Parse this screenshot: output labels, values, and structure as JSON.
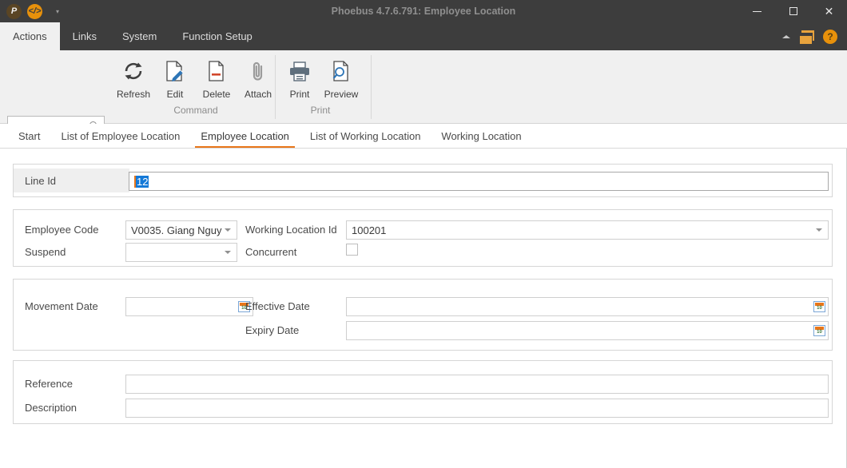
{
  "window": {
    "title": "Phoebus 4.7.6.791: Employee Location",
    "app_icon": "phoebus-logo-icon",
    "code_icon": "code-brackets-icon",
    "qat_caret": "▾",
    "minimize_label": "–",
    "maximize_label": "□",
    "close_label": "✕"
  },
  "menu": {
    "tabs": [
      {
        "label": "Actions",
        "active": true
      },
      {
        "label": "Links",
        "active": false
      },
      {
        "label": "System",
        "active": false
      },
      {
        "label": "Function Setup",
        "active": false
      }
    ],
    "collapse_icon": "chevron-up-icon",
    "windows_icon": "windows-tile-icon",
    "help_icon": "help-icon",
    "help_label": "?"
  },
  "ribbon": {
    "search": {
      "value": "",
      "placeholder": "",
      "icon": "search-icon"
    },
    "groups": [
      {
        "title": "Command",
        "buttons": [
          {
            "label": "Refresh",
            "icon": "refresh-icon"
          },
          {
            "label": "Edit",
            "icon": "edit-pencil-icon"
          },
          {
            "label": "Delete",
            "icon": "delete-document-icon"
          },
          {
            "label": "Attach",
            "icon": "paperclip-icon"
          }
        ]
      },
      {
        "title": "Print",
        "buttons": [
          {
            "label": "Print",
            "icon": "printer-icon"
          },
          {
            "label": "Preview",
            "icon": "print-preview-icon"
          }
        ]
      }
    ]
  },
  "doctabs": [
    {
      "label": "Start",
      "active": false
    },
    {
      "label": "List of Employee Location",
      "active": false
    },
    {
      "label": "Employee Location",
      "active": true
    },
    {
      "label": "List of Working Location",
      "active": false
    },
    {
      "label": "Working Location",
      "active": false
    }
  ],
  "form": {
    "line_id": {
      "label": "Line Id",
      "value": "12",
      "selected": true
    },
    "employee_code": {
      "label": "Employee Code",
      "value": "V0035. Giang  Nguy"
    },
    "working_location_id": {
      "label": "Working Location Id",
      "value": "100201"
    },
    "suspend": {
      "label": "Suspend",
      "value": ""
    },
    "concurrent": {
      "label": "Concurrent",
      "checked": false
    },
    "movement_date": {
      "label": "Movement Date",
      "value": "",
      "icon": "calendar-icon"
    },
    "effective_date": {
      "label": "Effective Date",
      "value": "",
      "icon": "calendar-icon"
    },
    "expiry_date": {
      "label": "Expiry Date",
      "value": "",
      "icon": "calendar-icon"
    },
    "reference": {
      "label": "Reference",
      "value": ""
    },
    "description": {
      "label": "Description",
      "value": ""
    }
  },
  "colors": {
    "accent_orange": "#e8761a",
    "titlebar": "#3d3d3d",
    "ribbon_bg": "#f0f0f0",
    "selection_blue": "#1479d7"
  }
}
